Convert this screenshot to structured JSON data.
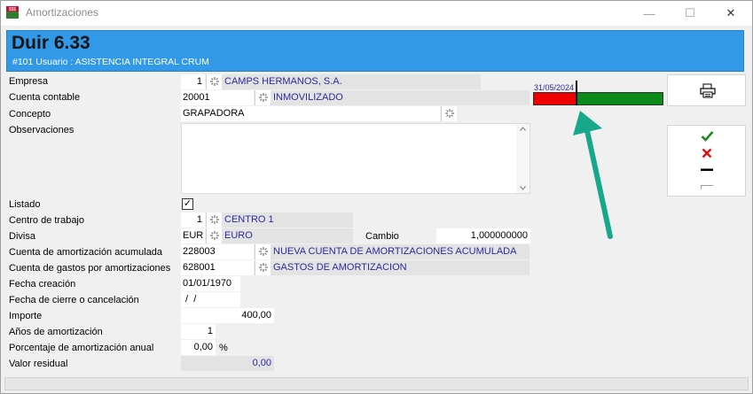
{
  "window": {
    "title": "Amortizaciones",
    "minimize_glyph": "—",
    "maximize_glyph": "☐",
    "close_glyph": "✕"
  },
  "header": {
    "title": "Duir 6.33",
    "subtitle": "#101 Usuario : ASISTENCIA INTEGRAL CRUM"
  },
  "form": {
    "empresa": {
      "label": "Empresa",
      "value": "1",
      "desc": "CAMPS HERMANOS, S.A."
    },
    "cuenta_contable": {
      "label": "Cuenta contable",
      "value": "20001",
      "desc": "INMOVILIZADO"
    },
    "concepto": {
      "label": "Concepto",
      "value": "GRAPADORA"
    },
    "observaciones": {
      "label": "Observaciones",
      "value": ""
    },
    "listado": {
      "label": "Listado",
      "checked": "✓"
    },
    "centro_trabajo": {
      "label": "Centro de trabajo",
      "value": "1",
      "desc": "CENTRO 1"
    },
    "divisa": {
      "label": "Divisa",
      "value": "EUR",
      "desc": "EURO"
    },
    "cambio": {
      "label": "Cambio",
      "value": "1,000000000"
    },
    "cuenta_amort_acum": {
      "label": "Cuenta de amortización acumulada",
      "value": "228003",
      "desc": "NUEVA CUENTA DE AMORTIZACIONES ACUMULADA"
    },
    "cuenta_gastos": {
      "label": "Cuenta de gastos por amortizaciones",
      "value": "628001",
      "desc": "GASTOS DE AMORTIZACION"
    },
    "fecha_creacion": {
      "label": "Fecha creación",
      "value": "01/01/1970"
    },
    "fecha_cierre": {
      "label": "Fecha de cierre o cancelación",
      "value": " /  /"
    },
    "importe": {
      "label": "Importe",
      "value": "400,00"
    },
    "anios": {
      "label": "Años de amortización",
      "value": "1"
    },
    "porcentaje": {
      "label": "Porcentaje de amortización anual",
      "value": "0,00",
      "unit": "%"
    },
    "valor_residual": {
      "label": "Valor residual",
      "value": "0,00"
    }
  },
  "gauge": {
    "date": "31/05/2024",
    "progress": 0.33,
    "colors": {
      "elapsed": "#ee0000",
      "remaining": "#0b8a1a"
    }
  },
  "colors": {
    "header_bg": "#3199e8",
    "link_text": "#2a2a9e",
    "accept": "#1b8a1b",
    "cancel": "#e01010",
    "annotation_arrow": "#17a78a"
  },
  "icons": {
    "print": "printer-icon",
    "accept": "checkmark-icon",
    "cancel": "x-icon",
    "minus": "minus-icon",
    "last": "line-icon",
    "lookup": "lookup-icon"
  }
}
